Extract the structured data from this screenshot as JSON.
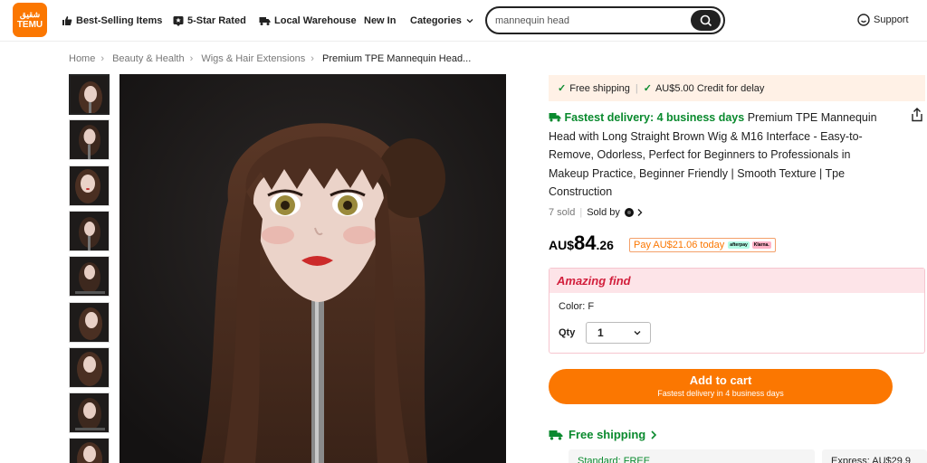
{
  "header": {
    "logo_top": "شقيق",
    "logo_text": "TEMU",
    "nav": {
      "best_selling": "Best-Selling Items",
      "five_star": "5-Star Rated",
      "local_warehouse": "Local Warehouse",
      "new_in": "New In",
      "categories": "Categories"
    },
    "search_value": "mannequin head",
    "support": "Support"
  },
  "breadcrumb": [
    "Home",
    "Beauty & Health",
    "Wigs & Hair Extensions",
    "Premium TPE Mannequin Head..."
  ],
  "product": {
    "promo_free_shipping": "Free shipping",
    "promo_credit": "AU$5.00 Credit for delay",
    "fastest_delivery": "Fastest delivery: 4 business days",
    "title": "Premium TPE Mannequin Head with Long Straight Brown Wig & M16 Interface - Easy-to-Remove, Odorless, Perfect for Beginners to Professionals in Makeup Practice, Beginner Friendly | Smooth Texture | Tpe Construction",
    "sold": "7 sold",
    "sold_by": "Sold by",
    "price_currency": "AU$",
    "price_whole": "84",
    "price_cents": ".26",
    "pay_later": "Pay AU$21.06 today",
    "pay_badge_1": "afterpay",
    "pay_badge_2": "Klarna.",
    "amazing_find": "Amazing find",
    "color_label": "Color: F",
    "qty_label": "Qty",
    "qty_value": "1",
    "add_to_cart": "Add to cart",
    "add_to_cart_sub": "Fastest delivery in 4 business days",
    "free_shipping": "Free shipping",
    "standard_shipping": "Standard: FREE",
    "express_shipping": "Express: AU$29.9"
  },
  "colors": {
    "brand": "#fb7701",
    "green": "#0a8a2e",
    "red": "#d21f3c"
  }
}
